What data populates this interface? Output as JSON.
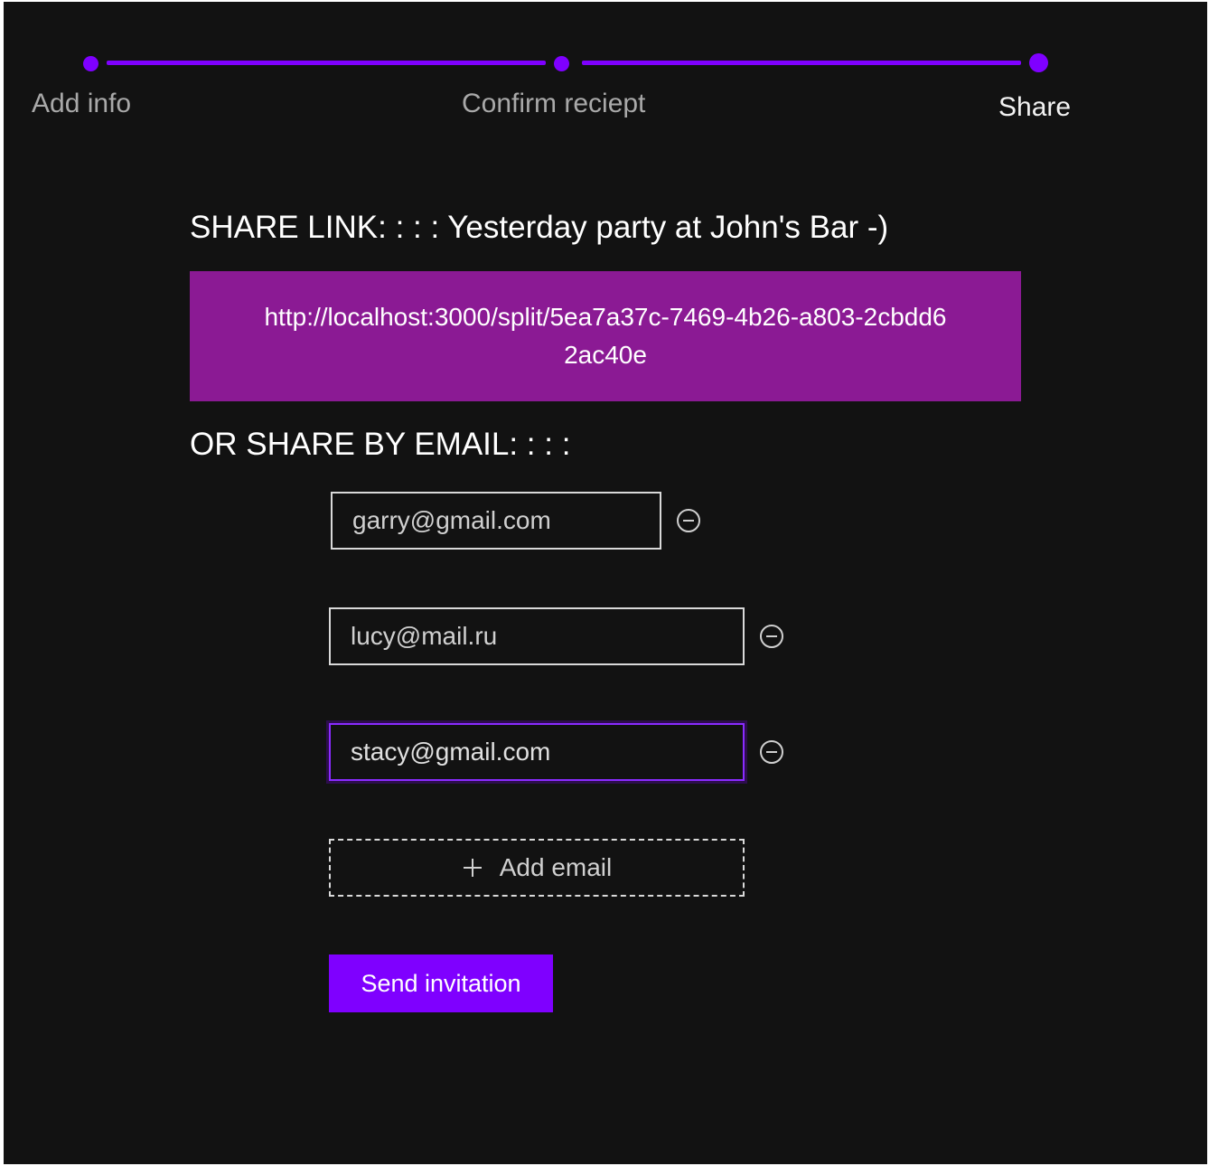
{
  "stepper": {
    "steps": [
      {
        "label": "Add info"
      },
      {
        "label": "Confirm reciept"
      },
      {
        "label": "Share"
      }
    ],
    "current_step": "Share",
    "accent_color": "#7f00ff"
  },
  "share_link": {
    "title": "SHARE LINK: : : : Yesterday party at John's Bar -)",
    "url": "http://localhost:3000/split/5ea7a37c-7469-4b26-a803-2cbdd62ac40e",
    "box_color": "#8b1a94"
  },
  "share_email": {
    "title": "OR SHARE BY EMAIL: : : :",
    "emails": [
      {
        "value": "garry@gmail.com",
        "remove_icon": "minus-circle-icon"
      },
      {
        "value": "lucy@mail.ru",
        "remove_icon": "minus-circle-icon"
      },
      {
        "value": "stacy@gmail.com",
        "remove_icon": "minus-circle-icon",
        "focused": true
      }
    ],
    "add_email_label": "Add email",
    "add_email_icon": "plus-icon"
  },
  "send_button": {
    "label": "Send invitation",
    "color": "#7f00ff"
  },
  "colors": {
    "background": "#121212",
    "text_primary": "#ffffff",
    "text_muted": "#a9a9a9"
  }
}
